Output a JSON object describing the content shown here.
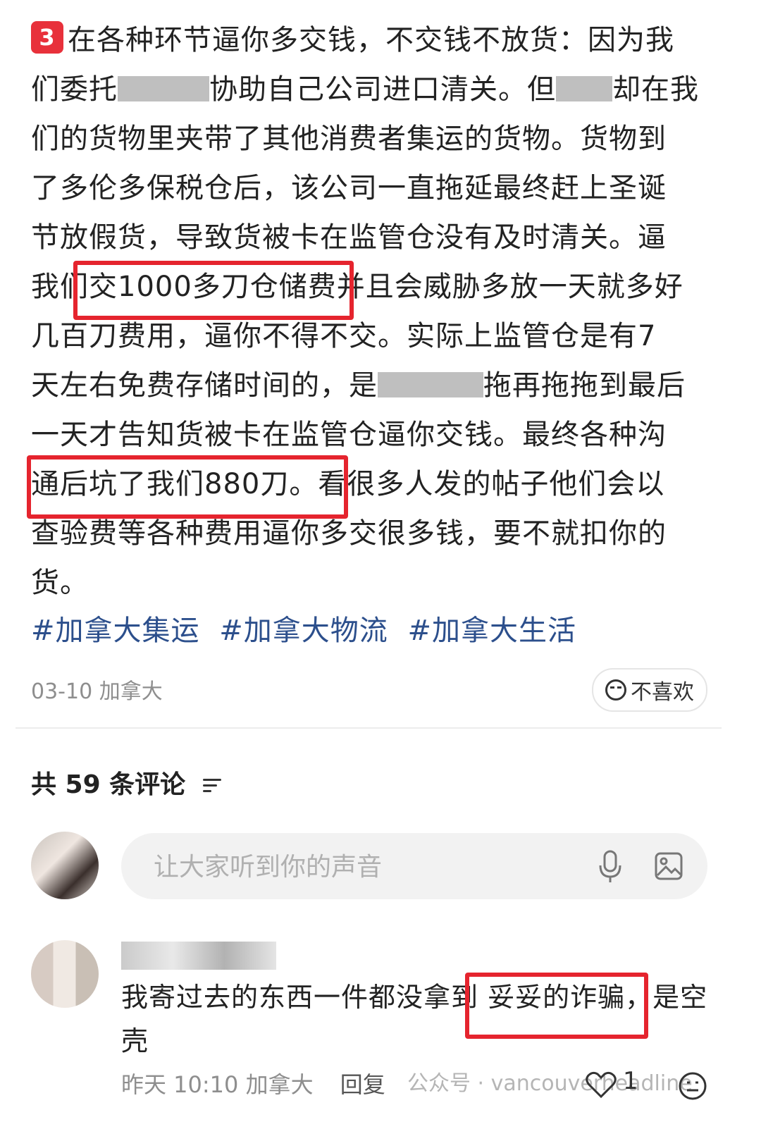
{
  "post": {
    "badge": "3",
    "lines": [
      {
        "text": "在各种环节逼你多交钱，不交钱不放货：因为我"
      },
      {
        "text_a": "们委托",
        "text_b": "协助自己公司进口清关。但",
        "text_c": "却在我"
      },
      {
        "text": "们的货物里夹带了其他消费者集运的货物。货物到"
      },
      {
        "text": "了多伦多保税仓后，该公司一直拖延最终赶上圣诞"
      },
      {
        "text": "节放假货，导致货被卡在监管仓没有及时清关。逼"
      },
      {
        "text": "我们交1000多刀仓储费并且会威胁多放一天就多好"
      },
      {
        "text": "几百刀费用，逼你不得不交。实际上监管仓是有7"
      },
      {
        "text_a": "天左右免费存储时间的，是",
        "text_c": "拖再拖拖到最后"
      },
      {
        "text": "一天才告知货被卡在监管仓逼你交钱。最终各种沟"
      },
      {
        "text": "通后坑了我们880刀。看很多人发的帖子他们会以"
      },
      {
        "text": "查验费等各种费用逼你多交很多钱，要不就扣你的"
      },
      {
        "text": "货。"
      }
    ],
    "hashtags": [
      "#加拿大集运",
      "#加拿大物流",
      "#加拿大生活"
    ],
    "meta": "03-10 加拿大",
    "dislike_label": "不喜欢"
  },
  "comments": {
    "header": "共 59 条评论",
    "input_placeholder": "让大家听到你的声音",
    "items": [
      {
        "text": "我寄过去的东西一件都没拿到 妥妥的诈骗，是空壳",
        "meta": "昨天 10:10 加拿大",
        "reply_label": "回复",
        "likes": "1"
      }
    ]
  },
  "watermark": "公众号 · vancouverheadline",
  "colors": {
    "highlight": "#e5242e",
    "hashtag": "#2c4f8c",
    "badge": "#e8313b"
  }
}
